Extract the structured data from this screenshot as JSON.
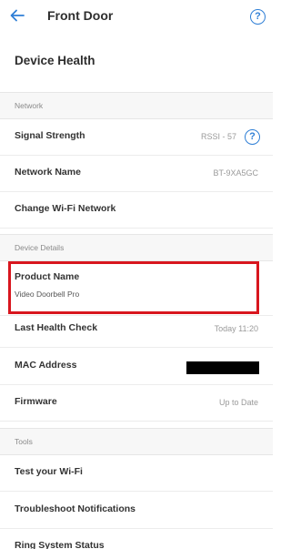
{
  "header": {
    "title": "Front Door",
    "back_icon": "back-arrow-icon",
    "help_icon": "help-icon",
    "help_glyph": "?"
  },
  "page_title": "Device Health",
  "sections": {
    "network": "Network",
    "device_details": "Device Details",
    "tools": "Tools"
  },
  "network": {
    "signal_strength": {
      "label": "Signal Strength",
      "value": "RSSI - 57"
    },
    "network_name": {
      "label": "Network Name",
      "value": "BT-9XA5GC"
    },
    "change_wifi": {
      "label": "Change Wi-Fi Network"
    }
  },
  "device_details": {
    "product_name": {
      "label": "Product Name",
      "value": "Video Doorbell Pro"
    },
    "last_health_check": {
      "label": "Last Health Check",
      "value": "Today 11:20"
    },
    "mac_address": {
      "label": "MAC Address"
    },
    "firmware": {
      "label": "Firmware",
      "value": "Up to Date"
    }
  },
  "tools": {
    "test_wifi": "Test your Wi-Fi",
    "troubleshoot": "Troubleshoot Notifications",
    "system_status": "Ring System Status"
  },
  "colors": {
    "accent": "#2f7fd6",
    "highlight": "#d8161e",
    "section_bg": "#f7f7f7"
  }
}
